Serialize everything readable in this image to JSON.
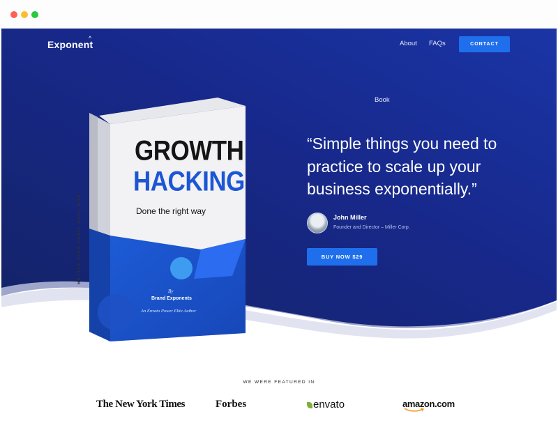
{
  "header": {
    "logo": "Exponent",
    "nav": [
      "Book",
      "About",
      "FAQs"
    ],
    "contact_label": "CONTACT"
  },
  "hero": {
    "quote": "“Simple things you need to practice to scale up your business exponentially.”",
    "author_name": "John Miller",
    "author_role": "Founder and Director – Miller Corp.",
    "buy_label": "BUY NOW $29",
    "colors": {
      "bg_dark": "#0f2470",
      "bg_light": "#1b3399",
      "accent": "#1f6fec"
    }
  },
  "book": {
    "title_line1": "GROWTH",
    "title_line2": "HACKING",
    "subtitle": "Done the right way",
    "by": "By",
    "author": "Brand Exponents",
    "tagline": "An Envato Power Elite Author",
    "spine": "NEW YORK TIMES BEST SELLER"
  },
  "featured": {
    "heading": "WE WERE FEATURED IN",
    "logos": [
      "The New York Times",
      "Forbes",
      "envato",
      "amazon.com"
    ]
  }
}
